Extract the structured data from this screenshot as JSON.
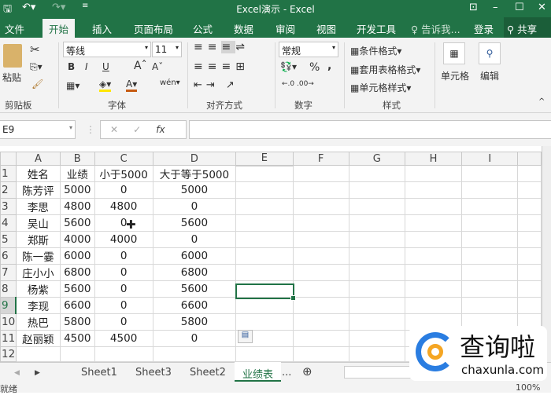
{
  "window": {
    "title": "Excel演示 - Excel"
  },
  "tabs": [
    "文件",
    "开始",
    "插入",
    "页面布局",
    "公式",
    "数据",
    "审阅",
    "视图",
    "开发工具"
  ],
  "tell_me": "告诉我...",
  "login": "登录",
  "share": "共享",
  "ribbon": {
    "paste": "粘贴",
    "font_name": "等线",
    "font_size": "11",
    "bold": "B",
    "italic": "I",
    "underline": "U",
    "number_format": "常规",
    "percent": "%",
    "comma": ",",
    "cond_format": "条件格式",
    "table_format": "套用表格格式",
    "cell_style": "单元格样式",
    "cells": "单元格",
    "edit": "编辑",
    "groups": [
      "剪贴板",
      "字体",
      "对齐方式",
      "数字",
      "样式"
    ]
  },
  "formula_bar": {
    "name_box": "E9",
    "fx": "fx",
    "formula": ""
  },
  "columns": [
    "A",
    "B",
    "C",
    "D",
    "E",
    "F",
    "G",
    "H",
    "I"
  ],
  "rows": [
    [
      "姓名",
      "业绩",
      "小于5000",
      "大于等于5000"
    ],
    [
      "陈芳评",
      "5000",
      "0",
      "5000"
    ],
    [
      "李思",
      "4800",
      "4800",
      "0"
    ],
    [
      "吴山",
      "5600",
      "0",
      "5600"
    ],
    [
      "郑斯",
      "4000",
      "4000",
      "0"
    ],
    [
      "陈一霎",
      "6000",
      "0",
      "6000"
    ],
    [
      "庄小小",
      "6800",
      "0",
      "6800"
    ],
    [
      "杨紫",
      "5600",
      "0",
      "5600"
    ],
    [
      "李现",
      "6600",
      "0",
      "6600"
    ],
    [
      "热巴",
      "5800",
      "0",
      "5800"
    ],
    [
      "赵丽颖",
      "4500",
      "4500",
      "0"
    ],
    [
      "",
      "",
      "",
      ""
    ],
    [
      "",
      "",
      "",
      ""
    ]
  ],
  "active_cell": "E9",
  "sheets": [
    "Sheet1",
    "Sheet3",
    "Sheet2",
    "业绩表"
  ],
  "active_sheet": "业绩表",
  "more_sheets": "...",
  "status": {
    "ready": "就绪",
    "zoom": "100%"
  },
  "watermark": {
    "text": "查询啦",
    "url": "chaxunla.com"
  },
  "colors": {
    "brand": "#217346"
  }
}
